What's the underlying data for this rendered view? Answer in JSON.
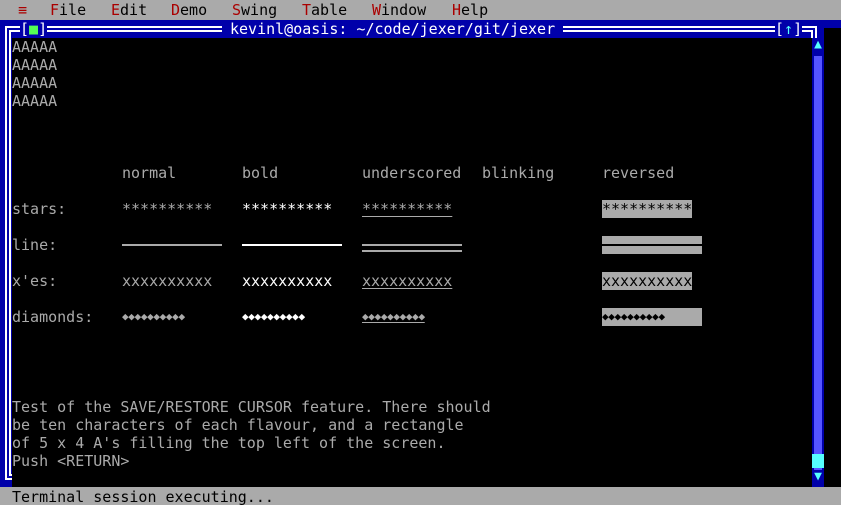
{
  "menubar": {
    "system_icon": "≡",
    "items": [
      {
        "accel": "F",
        "rest": "ile"
      },
      {
        "accel": "E",
        "rest": "dit"
      },
      {
        "accel": "D",
        "rest": "emo"
      },
      {
        "accel": "S",
        "rest": "wing"
      },
      {
        "accel": "T",
        "rest": "able"
      },
      {
        "accel": "W",
        "rest": "indow"
      },
      {
        "accel": "H",
        "rest": "elp"
      }
    ]
  },
  "window": {
    "title": "kevinl@oasis: ~/code/jexer/git/jexer",
    "close_icon": "■",
    "maximize_icon": "↑"
  },
  "terminal": {
    "rect_lines": [
      "AAAAA",
      "AAAAA",
      "AAAAA",
      "AAAAA"
    ],
    "headers": {
      "normal": "normal",
      "bold": "bold",
      "underscored": "underscored",
      "blinking": "blinking",
      "reversed": "reversed"
    },
    "rows": [
      {
        "label": "stars:",
        "sample": "**********",
        "kind": "text"
      },
      {
        "label": "line:",
        "sample": "",
        "kind": "line"
      },
      {
        "label": "x'es:",
        "sample": "xxxxxxxxxx",
        "kind": "text"
      },
      {
        "label": "diamonds:",
        "sample": "◆◆◆◆◆◆◆◆◆◆",
        "kind": "text"
      }
    ],
    "message_lines": [
      "Test of the SAVE/RESTORE CURSOR feature. There should",
      "be ten characters of each flavour, and a rectangle",
      "of 5 x 4 A's filling the top left of the screen.",
      "Push <RETURN>"
    ]
  },
  "statusbar": {
    "text": "Terminal session executing..."
  },
  "colors": {
    "desktop": "#0000aa",
    "menu_bg": "#aaaaaa",
    "accel": "#aa0000",
    "terminal_bg": "#000000",
    "terminal_fg": "#aaaaaa",
    "bright": "#ffffff",
    "scroll_arrow": "#55ffff"
  }
}
